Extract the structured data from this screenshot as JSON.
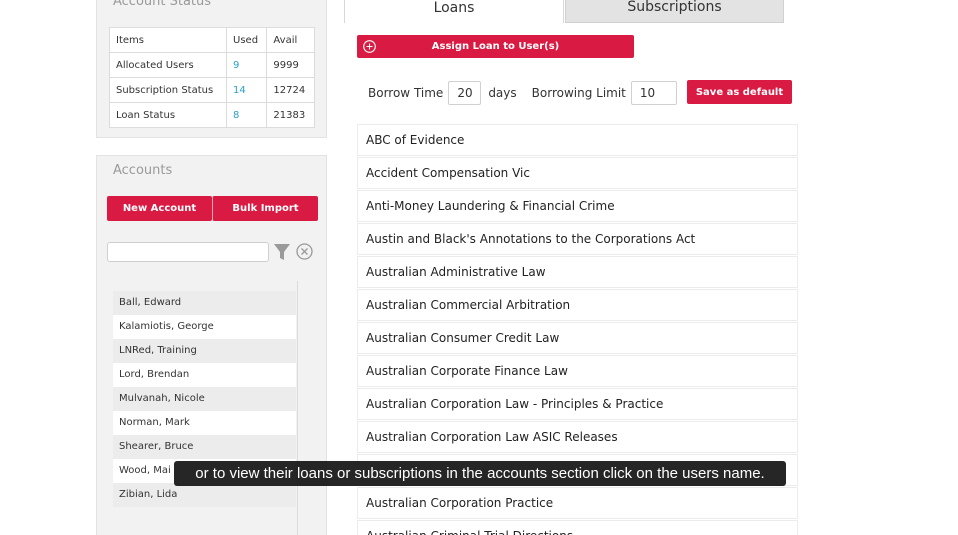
{
  "account_status": {
    "title": "Account Status",
    "headers": [
      "Items",
      "Used",
      "Avail"
    ],
    "rows": [
      {
        "item": "Allocated Users",
        "used": "9",
        "avail": "9999"
      },
      {
        "item": "Subscription Status",
        "used": "14",
        "avail": "12724"
      },
      {
        "item": "Loan Status",
        "used": "8",
        "avail": "21383"
      }
    ]
  },
  "accounts": {
    "title": "Accounts",
    "new_account_label": "New Account",
    "bulk_import_label": "Bulk Import",
    "search_value": "",
    "users": [
      "Ball, Edward",
      "Kalamiotis, George",
      "LNRed, Training",
      "Lord, Brendan",
      "Mulvanah, Nicole",
      "Norman, Mark",
      "Shearer, Bruce",
      "Wood, Mai",
      "Zibian, Lida"
    ]
  },
  "tabs": {
    "loans": "Loans",
    "subscriptions": "Subscriptions"
  },
  "loans": {
    "assign_label": "Assign Loan to User(s)",
    "borrow_time_label": "Borrow Time",
    "borrow_time_value": "20",
    "days_label": "days",
    "borrowing_limit_label": "Borrowing Limit",
    "borrowing_limit_value": "10",
    "save_default_label": "Save as default",
    "titles": [
      "ABC of Evidence",
      "Accident Compensation Vic",
      "Anti-Money Laundering & Financial Crime",
      "Austin and Black's Annotations to the Corporations Act",
      "Australian Administrative Law",
      "Australian Commercial Arbitration",
      "Australian Consumer Credit Law",
      "Australian Corporate Finance Law",
      "Australian Corporation Law - Principles & Practice",
      "Australian Corporation Law ASIC Releases",
      "",
      "Australian Corporation Practice",
      "Australian Criminal Trial Directions"
    ]
  },
  "caption": "or to view their loans or subscriptions in the accounts section click on the users name.",
  "colors": {
    "accent_red": "#d91a43",
    "link_blue": "#2a9fc9"
  }
}
